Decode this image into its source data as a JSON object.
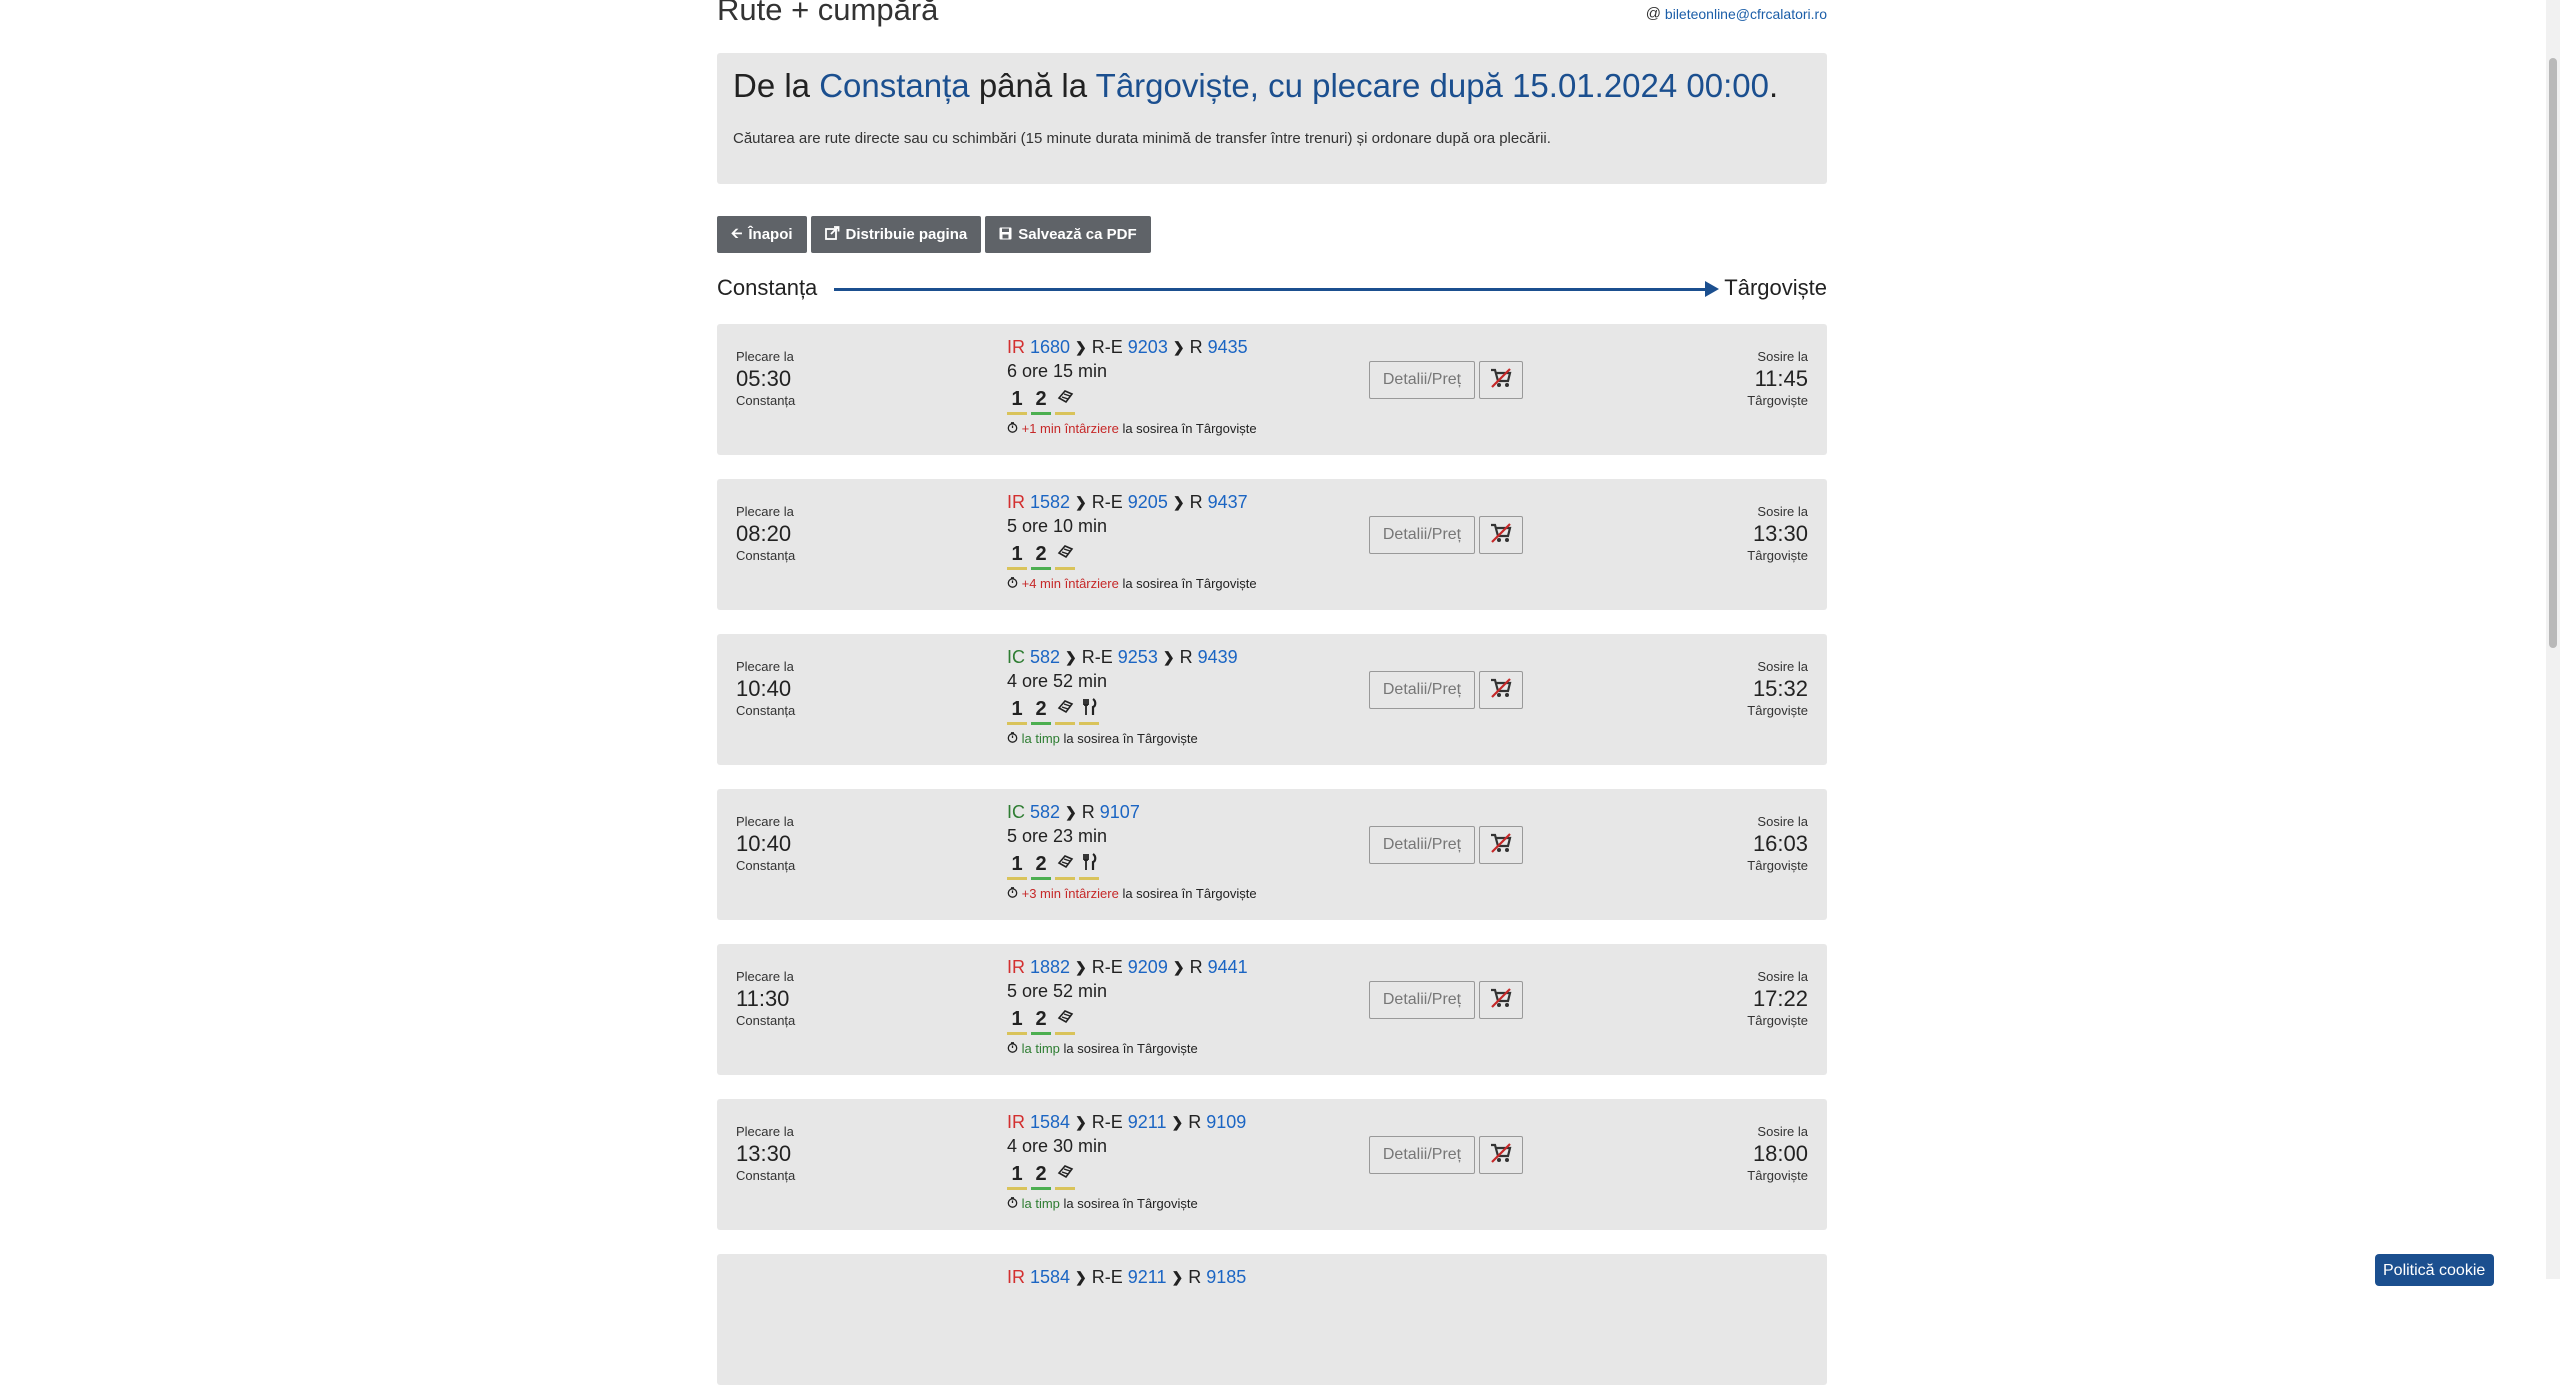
{
  "page": {
    "title": "Rute + cumpără",
    "email": "bileteonline@cfrcalatori.ro"
  },
  "hero": {
    "prefix": "De la",
    "from": "Constanța",
    "mid": "până la",
    "to": "Târgoviște",
    "suffix": ", cu plecare după 15.01.2024 00:00",
    "dot": ".",
    "description": "Căutarea are rute directe sau cu schimbări (15 minute durata minimă de transfer între trenuri) și ordonare după ora plecării."
  },
  "buttons": {
    "back": "Înapoi",
    "share": "Distribuie pagina",
    "pdf": "Salvează ca PDF"
  },
  "route": {
    "from": "Constanța",
    "to": "Târgoviște"
  },
  "labels": {
    "departure": "Plecare la",
    "arrival": "Sosire la",
    "details": "Detalii/Preț",
    "arrival_suffix": "la sosirea în Târgoviște"
  },
  "journeys": [
    {
      "dep": "05:30",
      "arr": "11:45",
      "from": "Constanța",
      "to": "Târgoviște",
      "trains": [
        {
          "cat": "IR",
          "num": "1680"
        },
        {
          "cat": "R-E",
          "num": "9203"
        },
        {
          "cat": "R",
          "num": "9435"
        }
      ],
      "duration": "6 ore 15 min",
      "dining": false,
      "status": "+1 min întârziere",
      "late": true
    },
    {
      "dep": "08:20",
      "arr": "13:30",
      "from": "Constanța",
      "to": "Târgoviște",
      "trains": [
        {
          "cat": "IR",
          "num": "1582"
        },
        {
          "cat": "R-E",
          "num": "9205"
        },
        {
          "cat": "R",
          "num": "9437"
        }
      ],
      "duration": "5 ore 10 min",
      "dining": false,
      "status": "+4 min întârziere",
      "late": true
    },
    {
      "dep": "10:40",
      "arr": "15:32",
      "from": "Constanța",
      "to": "Târgoviște",
      "trains": [
        {
          "cat": "IC",
          "num": "582"
        },
        {
          "cat": "R-E",
          "num": "9253"
        },
        {
          "cat": "R",
          "num": "9439"
        }
      ],
      "duration": "4 ore 52 min",
      "dining": true,
      "status": "la timp",
      "late": false
    },
    {
      "dep": "10:40",
      "arr": "16:03",
      "from": "Constanța",
      "to": "Târgoviște",
      "trains": [
        {
          "cat": "IC",
          "num": "582"
        },
        {
          "cat": "R",
          "num": "9107"
        }
      ],
      "duration": "5 ore 23 min",
      "dining": true,
      "status": "+3 min întârziere",
      "late": true
    },
    {
      "dep": "11:30",
      "arr": "17:22",
      "from": "Constanța",
      "to": "Târgoviște",
      "trains": [
        {
          "cat": "IR",
          "num": "1882"
        },
        {
          "cat": "R-E",
          "num": "9209"
        },
        {
          "cat": "R",
          "num": "9441"
        }
      ],
      "duration": "5 ore 52 min",
      "dining": false,
      "status": "la timp",
      "late": false
    },
    {
      "dep": "13:30",
      "arr": "18:00",
      "from": "Constanța",
      "to": "Târgoviște",
      "trains": [
        {
          "cat": "IR",
          "num": "1584"
        },
        {
          "cat": "R-E",
          "num": "9211"
        },
        {
          "cat": "R",
          "num": "9109"
        }
      ],
      "duration": "4 ore 30 min",
      "dining": false,
      "status": "la timp",
      "late": false
    },
    {
      "dep": "",
      "arr": "",
      "from": "",
      "to": "",
      "trains": [
        {
          "cat": "IR",
          "num": "1584"
        },
        {
          "cat": "R-E",
          "num": "9211"
        },
        {
          "cat": "R",
          "num": "9185"
        }
      ],
      "duration": "",
      "dining": false,
      "status": "",
      "late": false,
      "partial": true
    }
  ],
  "cookie": "Politică cookie",
  "colors": {
    "accent": "#1b4f8f",
    "link": "#1b65c3",
    "ir": "#d32f2f",
    "ic": "#2e7d32",
    "late": "#c62828",
    "ontime": "#2e7d32"
  }
}
